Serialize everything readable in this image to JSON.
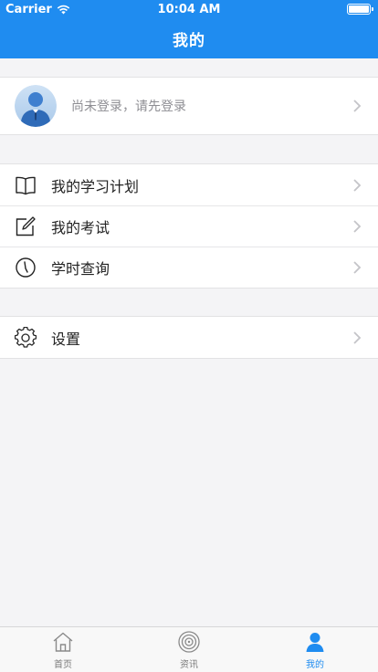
{
  "status_bar": {
    "carrier": "Carrier",
    "time": "10:04 AM"
  },
  "nav": {
    "title": "我的"
  },
  "profile": {
    "prompt": "尚未登录，请先登录"
  },
  "menu_group_1": [
    {
      "label": "我的学习计划",
      "icon": "book-icon"
    },
    {
      "label": "我的考试",
      "icon": "edit-icon"
    },
    {
      "label": "学时查询",
      "icon": "clock-icon"
    }
  ],
  "menu_group_2": [
    {
      "label": "设置",
      "icon": "gear-icon"
    }
  ],
  "tabbar": {
    "items": [
      {
        "label": "首页",
        "icon": "home-icon",
        "active": false
      },
      {
        "label": "资讯",
        "icon": "news-icon",
        "active": false
      },
      {
        "label": "我的",
        "icon": "user-icon",
        "active": true
      }
    ]
  },
  "colors": {
    "accent": "#1f8cf0",
    "background": "#f4f4f6"
  }
}
